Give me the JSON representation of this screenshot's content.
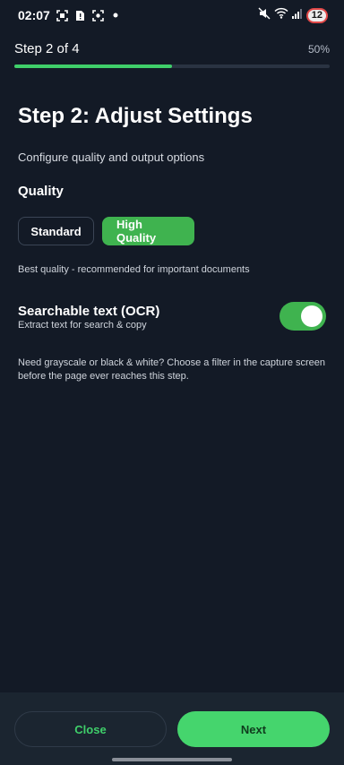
{
  "status_bar": {
    "time": "02:07",
    "left_icons": [
      "screenshot-icon",
      "sim-alert-icon",
      "focus-icon",
      "dot-icon"
    ],
    "right_icons": [
      "mute-icon",
      "wifi-icon",
      "signal-icon"
    ],
    "battery_level": "12"
  },
  "header": {
    "step_label": "Step 2 of 4",
    "percent_label": "50%",
    "progress_fraction": 0.5
  },
  "main": {
    "title": "Step 2: Adjust Settings",
    "subtitle": "Configure quality and output options",
    "quality": {
      "label": "Quality",
      "options": [
        "Standard",
        "High Quality"
      ],
      "selected": "High Quality",
      "hint": "Best quality - recommended for important documents"
    },
    "ocr": {
      "title": "Searchable text (OCR)",
      "subtitle": "Extract text for search & copy",
      "enabled": true
    },
    "filter_note": "Need grayscale or black & white? Choose a filter in the capture screen before the page ever reaches this step."
  },
  "footer": {
    "close_label": "Close",
    "next_label": "Next"
  },
  "colors": {
    "background": "#131a26",
    "accent": "#3fb34f",
    "accent_bright": "#45d56d"
  }
}
